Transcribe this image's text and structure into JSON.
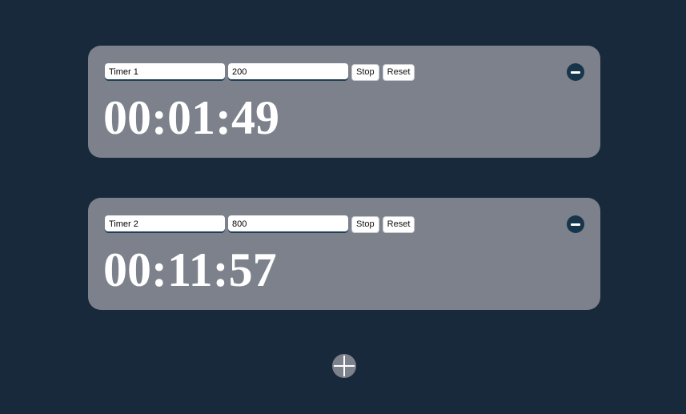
{
  "timers": [
    {
      "name": "Timer 1",
      "seconds": "200",
      "stop_label": "Stop",
      "reset_label": "Reset",
      "display": "00:01:49"
    },
    {
      "name": "Timer 2",
      "seconds": "800",
      "stop_label": "Stop",
      "reset_label": "Reset",
      "display": "00:11:57"
    }
  ],
  "icons": {
    "remove": "minus-circle-icon",
    "add": "plus-circle-icon"
  },
  "colors": {
    "background": "#17293b",
    "card": "#7c818b",
    "accent": "#16354a",
    "display_text": "#ffffff"
  }
}
